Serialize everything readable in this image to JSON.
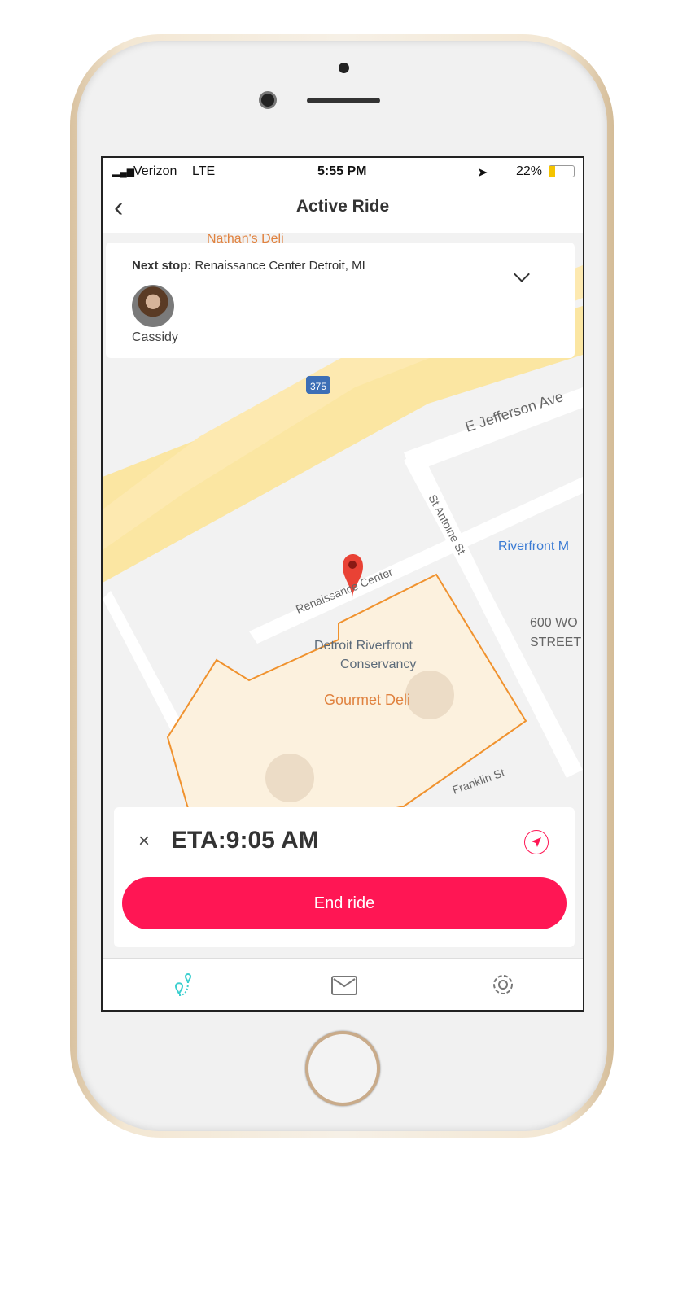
{
  "status_bar": {
    "carrier": "Verizon",
    "network": "LTE",
    "time": "5:55 PM",
    "battery": "22%",
    "battery_level": 0.22
  },
  "nav": {
    "title": "Active Ride",
    "back_icon": "chevron-left-icon"
  },
  "map": {
    "labels": {
      "nathans": "Nathan's Deli",
      "jefferson": "E Jefferson Ave",
      "st_antoine": "St Antoine St",
      "renaissance": "Renaissance Center",
      "conservancy_1": "Detroit Riverfront",
      "conservancy_2": "Conservancy",
      "gourmet": "Gourmet Deli",
      "riverfront": "Riverfront M",
      "wo_1": "600 WO",
      "wo_2": "STREET",
      "franklin": "Franklin St",
      "i375": "375"
    },
    "colors": {
      "highway": "#fbe6a2",
      "outline": "#f0922e",
      "pin": "#e94235"
    }
  },
  "next_stop": {
    "label": "Next stop:",
    "value": "Renaissance Center Detroit, MI",
    "rider": "Cassidy"
  },
  "ride": {
    "eta": "ETA:9:05 AM",
    "end_label": "End ride",
    "accent": "#ff1654"
  },
  "tabs": [
    {
      "icon": "route-icon",
      "active": true
    },
    {
      "icon": "mail-icon"
    },
    {
      "icon": "gear-icon"
    }
  ]
}
